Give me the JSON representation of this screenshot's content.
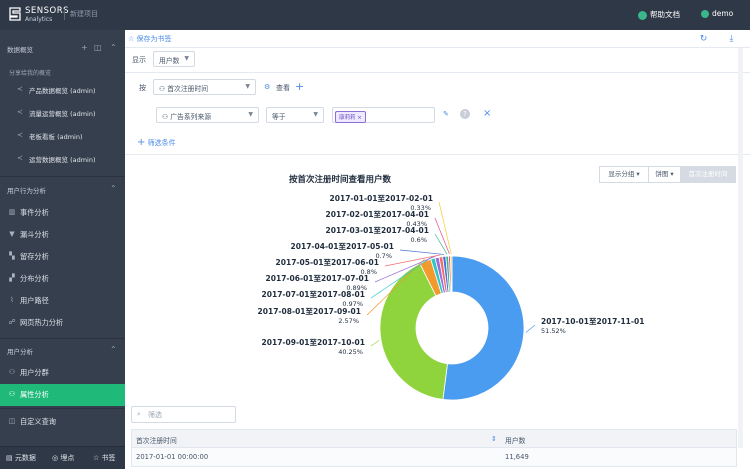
{
  "header": {
    "brand_line1": "SENSORS",
    "brand_line2": "Analytics",
    "project": "新建项目",
    "help_label": "帮助文档",
    "user_name": "demo"
  },
  "sidebar": {
    "overview_title": "数据概览",
    "shared_title": "分享给我的概览",
    "shared_items": [
      "产品数据概览 (admin)",
      "流量运营概览 (admin)",
      "老板看板 (admin)",
      "运营数据概览 (admin)"
    ],
    "behavior_title": "用户行为分析",
    "behavior_items": [
      "事件分析",
      "漏斗分析",
      "留存分析",
      "分布分析",
      "用户路径",
      "网页热力分析"
    ],
    "user_title": "用户分析",
    "user_items": [
      "用户分群",
      "属性分析"
    ],
    "custom_query": "自定义查询",
    "bottom": [
      "元数据",
      "埋点",
      "书签"
    ]
  },
  "toolbar": {
    "bookmark_label": "保存为书签"
  },
  "controls": {
    "display_label": "显示",
    "metric": "用户数",
    "by_label": "按",
    "group_by": "首次注册时间",
    "view_label": "查看",
    "filter_property": "广告系列来源",
    "operator": "等于",
    "filter_value_tag": "康莉莉",
    "add_filter": "筛选条件"
  },
  "chart_buttons": {
    "group": "显示分组",
    "chart": "饼图",
    "dim": "首次注册时间"
  },
  "chart_data": {
    "type": "pie",
    "donut": true,
    "title": "按首次注册时间查看用户数",
    "slices": [
      {
        "label": "2017-10-01至2017-11-01",
        "value": 51.52,
        "pct": "51.52%",
        "color": "#4a9cf0"
      },
      {
        "label": "2017-09-01至2017-10-01",
        "value": 40.25,
        "pct": "40.25%",
        "color": "#8fd43c"
      },
      {
        "label": "2017-08-01至2017-09-01",
        "value": 2.57,
        "pct": "2.57%",
        "color": "#f29a2e"
      },
      {
        "label": "2017-07-01至2017-08-01",
        "value": 0.97,
        "pct": "0.97%",
        "color": "#2fc6c8"
      },
      {
        "label": "2017-06-01至2017-07-01",
        "value": 0.89,
        "pct": "0.89%",
        "color": "#9b6fd8"
      },
      {
        "label": "2017-05-01至2017-06-01",
        "value": 0.8,
        "pct": "0.8%",
        "color": "#f26d6d"
      },
      {
        "label": "2017-04-01至2017-05-01",
        "value": 0.7,
        "pct": "0.7%",
        "color": "#4b6fd6"
      },
      {
        "label": "2017-03-01至2017-04-01",
        "value": 0.6,
        "pct": "0.6%",
        "color": "#3ab68a"
      },
      {
        "label": "2017-02-01至2017-04-01",
        "value": 0.43,
        "pct": "0.43%",
        "color": "#e64b8c"
      },
      {
        "label": "2017-01-01至2017-02-01",
        "value": 0.33,
        "pct": "0.33%",
        "color": "#f2d02e"
      }
    ]
  },
  "table": {
    "filter_placeholder": "筛选",
    "columns": [
      "首次注册时间",
      "用户数"
    ],
    "rows": [
      [
        "2017-01-01 00:00:00",
        "11,649"
      ]
    ]
  }
}
